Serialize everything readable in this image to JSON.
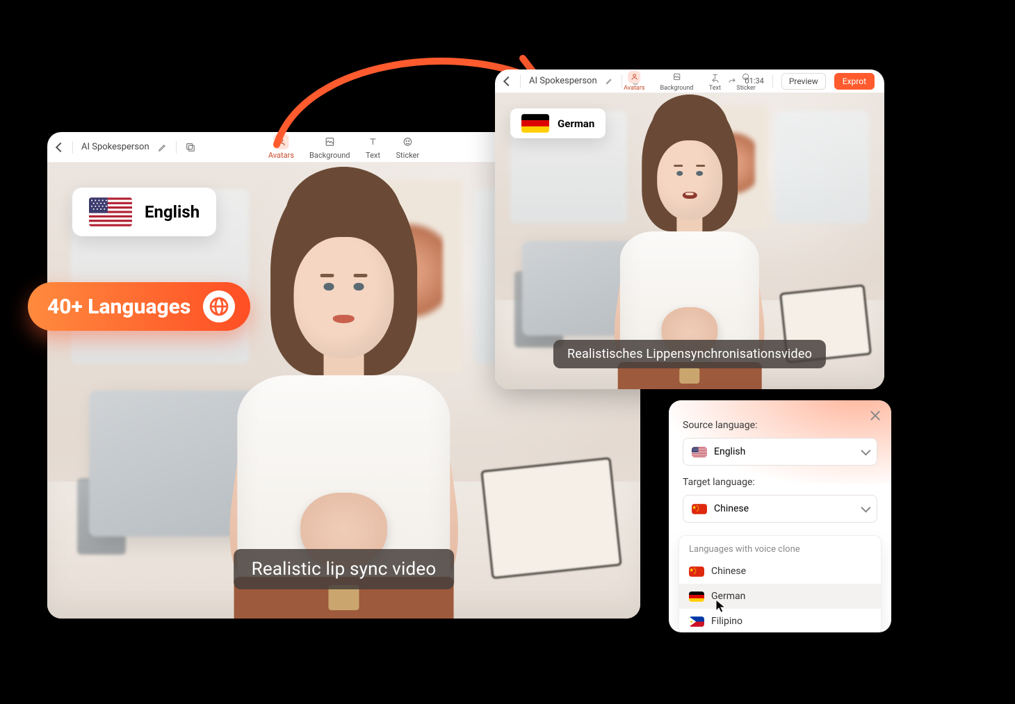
{
  "big_editor": {
    "title": "AI Spokesperson",
    "tabs": [
      {
        "id": "avatars",
        "label": "Avatars",
        "active": true
      },
      {
        "id": "background",
        "label": "Background",
        "active": false
      },
      {
        "id": "text",
        "label": "Text",
        "active": false
      },
      {
        "id": "sticker",
        "label": "Sticker",
        "active": false
      }
    ],
    "badge_language": "English",
    "caption": "Realistic lip sync video"
  },
  "small_editor": {
    "title": "AI Spokesperson",
    "tabs": [
      {
        "id": "avatars",
        "label": "Avatars",
        "active": true
      },
      {
        "id": "background",
        "label": "Background",
        "active": false
      },
      {
        "id": "text",
        "label": "Text",
        "active": false
      },
      {
        "id": "sticker",
        "label": "Sticker",
        "active": false
      }
    ],
    "timecode": "01:34",
    "preview_label": "Preview",
    "export_label": "Exprot",
    "badge_language": "German",
    "caption": "Realistisches Lippensynchronisationsvideo"
  },
  "pill_label": "40+ Languages",
  "picker": {
    "source_label": "Source language:",
    "source_value": "English",
    "target_label": "Target language:",
    "target_value": "Chinese",
    "group_title": "Languages with voice clone",
    "options": [
      {
        "id": "chinese",
        "label": "Chinese",
        "flag": "cn"
      },
      {
        "id": "german",
        "label": "German",
        "flag": "de",
        "hovered": true
      },
      {
        "id": "filipino",
        "label": "Filipino",
        "flag": "ph"
      }
    ]
  }
}
